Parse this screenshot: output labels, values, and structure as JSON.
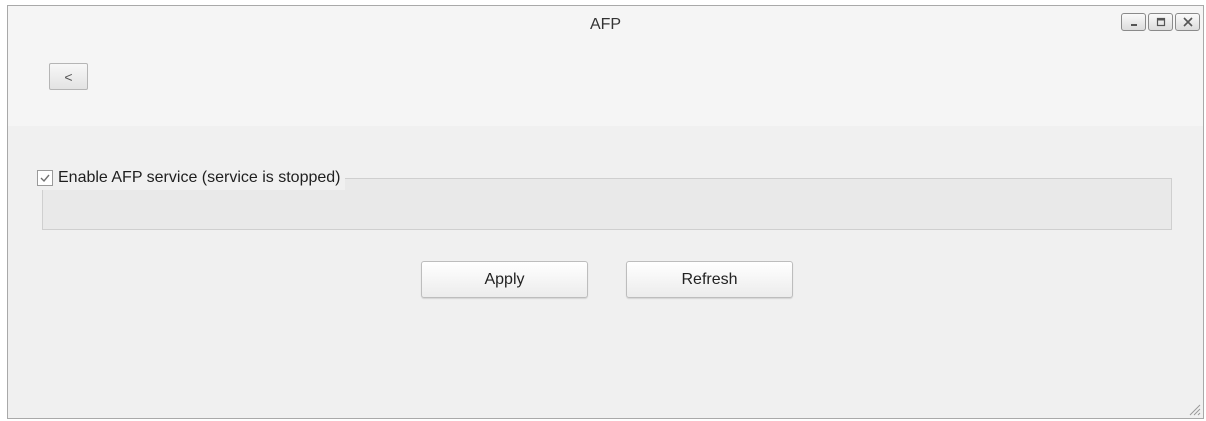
{
  "window": {
    "title": "AFP",
    "controls": {
      "minimize_icon": "minimize-icon",
      "maximize_icon": "maximize-icon",
      "close_icon": "close-icon"
    }
  },
  "nav": {
    "back_label": "<"
  },
  "service": {
    "enable_label": "Enable AFP service (service is stopped)",
    "enabled": true
  },
  "actions": {
    "apply_label": "Apply",
    "refresh_label": "Refresh"
  }
}
